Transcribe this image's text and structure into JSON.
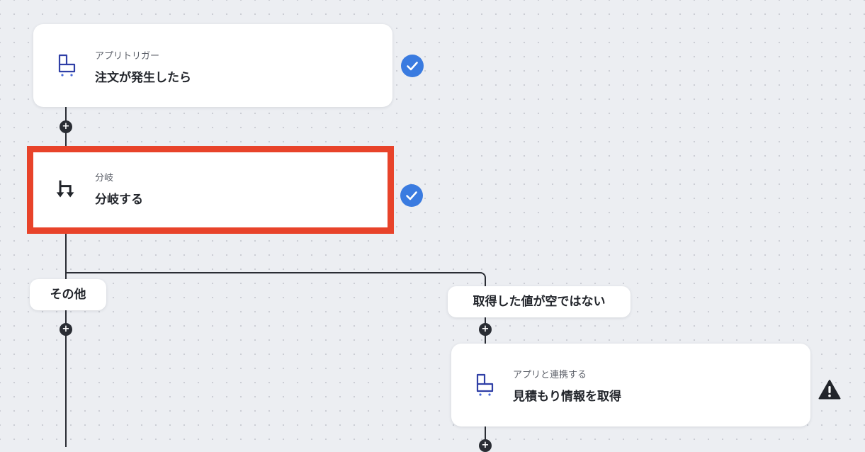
{
  "flow": {
    "trigger": {
      "kind": "アプリトリガー",
      "title": "注文が発生したら",
      "icon": "shopping-cart-icon",
      "status": "completed",
      "status_icon": "check-icon"
    },
    "branch": {
      "kind": "分岐",
      "title": "分岐する",
      "icon": "branch-icon",
      "status": "completed",
      "status_icon": "check-icon"
    },
    "branches": [
      {
        "label": "その他"
      },
      {
        "label": "取得した値が空ではない"
      }
    ],
    "action": {
      "kind": "アプリと連携する",
      "title": "見積もり情報を取得",
      "icon": "shopping-cart-icon",
      "status": "warning",
      "status_icon": "warning-icon"
    },
    "add_step_icon": "plus-icon"
  },
  "colors": {
    "canvas_background": "#eceef2",
    "connector": "#2a2d34",
    "highlight_border": "#e8432a",
    "check_badge": "#3a7be0",
    "cart_icon": "#2f3fa6"
  }
}
